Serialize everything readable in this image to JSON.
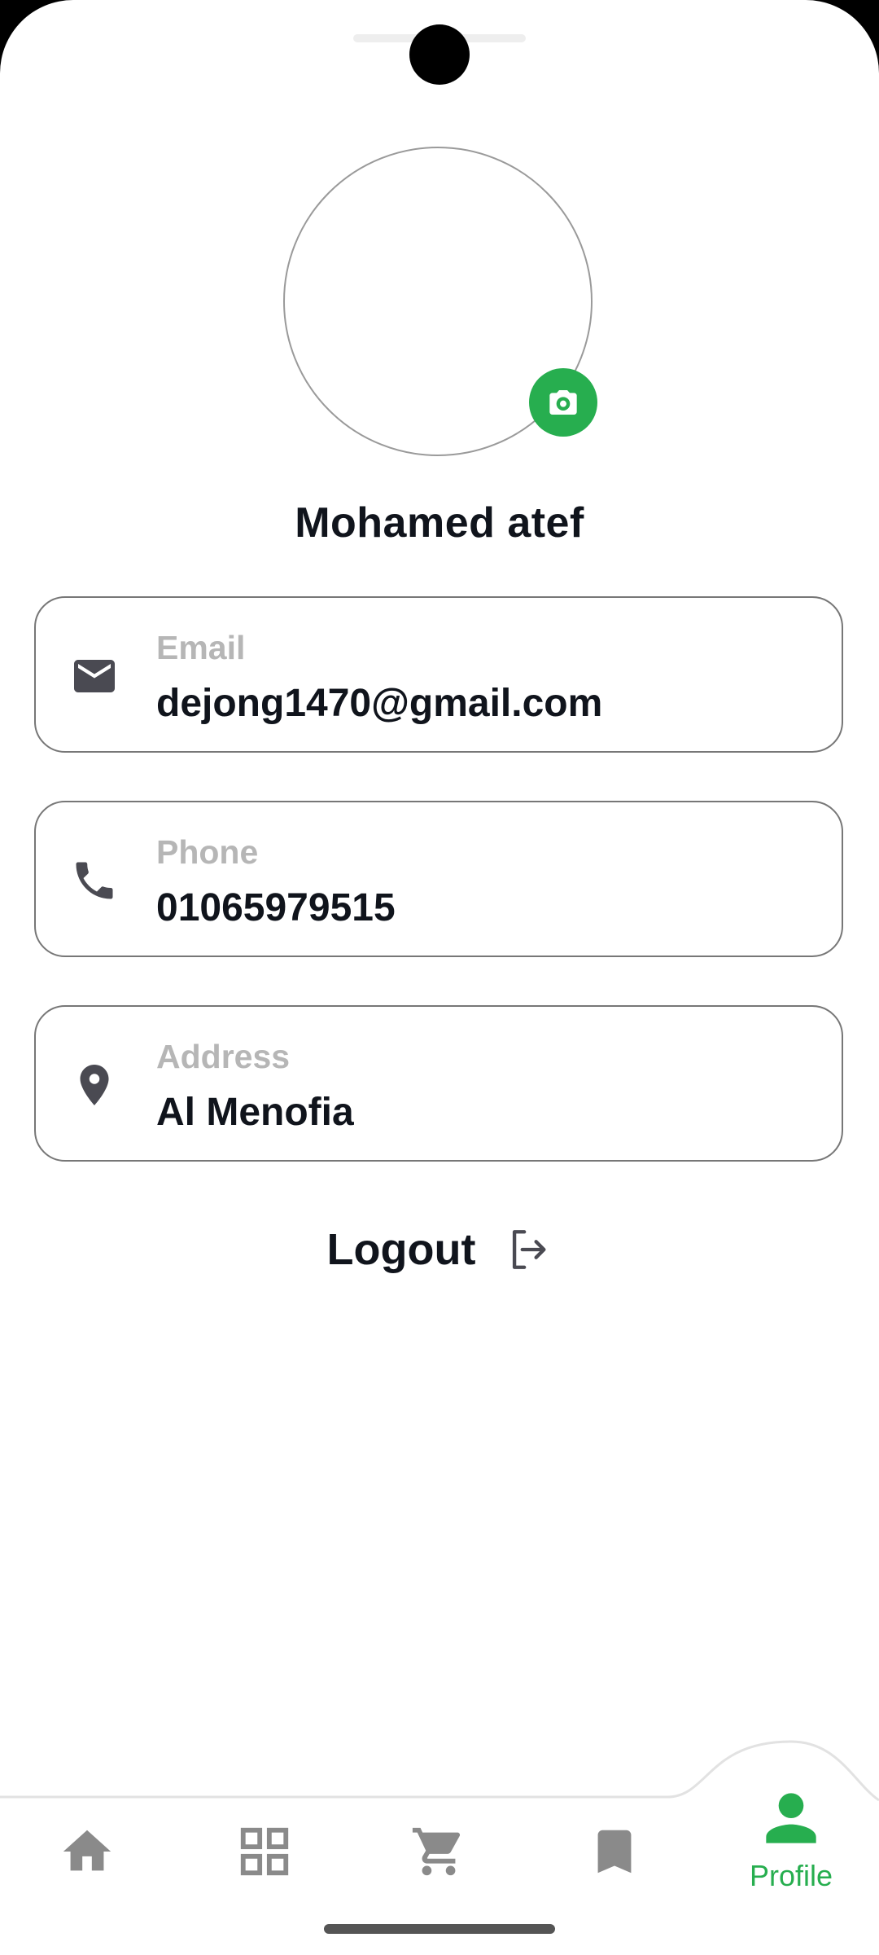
{
  "profile": {
    "name": "Mohamed atef"
  },
  "fields": {
    "email": {
      "label": "Email",
      "value": "dejong1470@gmail.com",
      "icon": "mail-icon"
    },
    "phone": {
      "label": "Phone",
      "value": "01065979515",
      "icon": "phone-icon"
    },
    "address": {
      "label": "Address",
      "value": "Al Menofia",
      "icon": "location-pin-icon"
    }
  },
  "logout": {
    "label": "Logout",
    "icon": "logout-icon"
  },
  "nav": {
    "items": [
      {
        "name": "home",
        "icon": "home-icon"
      },
      {
        "name": "categories",
        "icon": "grid-icon"
      },
      {
        "name": "cart",
        "icon": "cart-icon"
      },
      {
        "name": "saved",
        "icon": "bookmark-icon"
      }
    ],
    "active": {
      "label": "Profile",
      "icon": "person-icon"
    }
  },
  "colors": {
    "accent": "#27ae4f",
    "text": "#10141c",
    "label": "#b6b6b6",
    "icon": "#4a4a52",
    "nav_inactive": "#8a8a8a"
  }
}
